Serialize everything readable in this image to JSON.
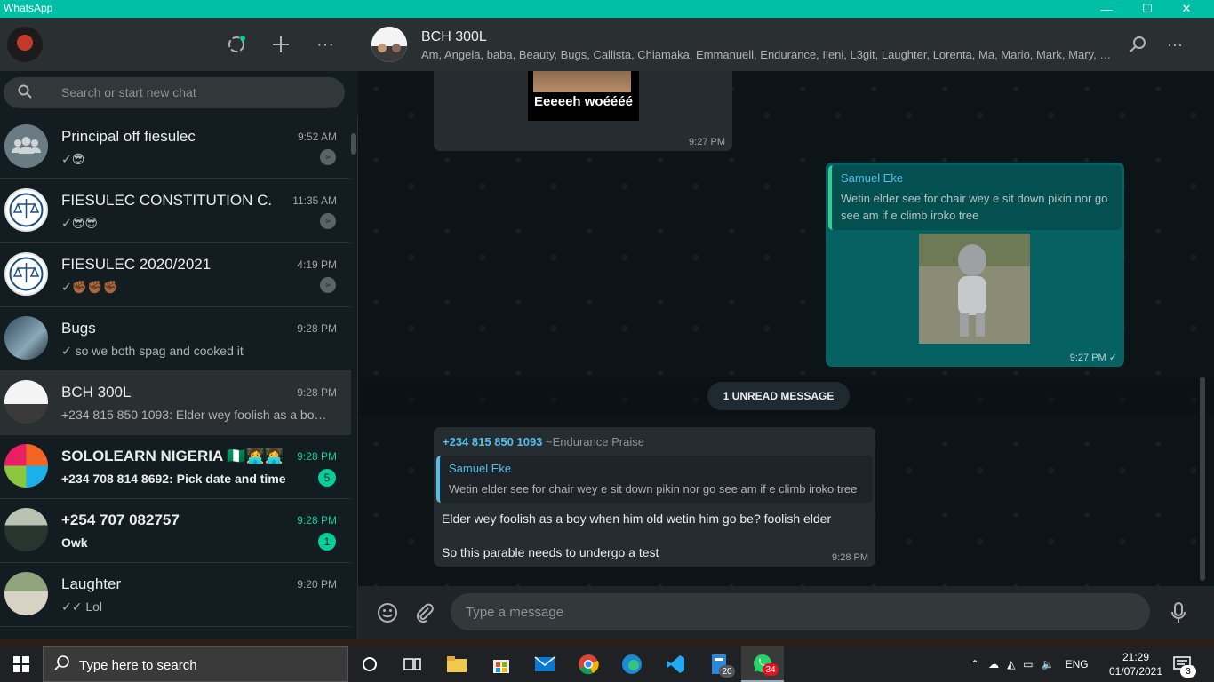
{
  "window": {
    "title": "WhatsApp"
  },
  "left_header": {
    "search_placeholder": "Search or start new chat"
  },
  "chats": [
    {
      "name": "Principal off fiesulec",
      "time": "9:52 AM",
      "preview": "✓😎",
      "pinned": true,
      "unread": "",
      "bold": false
    },
    {
      "name": "FIESULEC CONSTITUTION C.",
      "time": "11:35 AM",
      "preview": "✓😎😎",
      "pinned": true,
      "unread": "",
      "bold": false
    },
    {
      "name": "FIESULEC 2020/2021",
      "time": "4:19 PM",
      "preview": "✓✊🏾✊🏾✊🏾",
      "pinned": true,
      "unread": "",
      "bold": false
    },
    {
      "name": "Bugs",
      "time": "9:28 PM",
      "preview": "✓ so we both spag and cooked it",
      "pinned": false,
      "unread": "",
      "bold": false
    },
    {
      "name": "BCH 300L",
      "time": "9:28 PM",
      "preview": "+234 815 850 1093: Elder wey foolish as a boy ...",
      "pinned": false,
      "unread": "",
      "bold": false
    },
    {
      "name": "SOLOLEARN NIGERIA 🇳🇬👩‍💻👩‍💻",
      "time": "9:28 PM",
      "preview": "+234 708 814 8692: Pick date and time",
      "pinned": false,
      "unread": "5",
      "bold": true
    },
    {
      "name": "+254 707 082757",
      "time": "9:28 PM",
      "preview": "Owk",
      "pinned": false,
      "unread": "1",
      "bold": true
    },
    {
      "name": "Laughter",
      "time": "9:20 PM",
      "preview": "✓✓ Lol",
      "pinned": false,
      "unread": "",
      "bold": false
    }
  ],
  "conversation": {
    "title": "BCH 300L",
    "members": "Am, Angela, baba, Beauty, Bugs, Callista, Chiamaka, Emmanuell, Endurance, Ileni, L3git, Laughter, Lorenta, Ma, Mario, Mark, Mary, My...",
    "messages": {
      "first": {
        "image_caption": "Eeeeeh woéééé",
        "time": "9:27 PM"
      },
      "outgoing": {
        "quote_author": "Samuel Eke",
        "quote_text": "Wetin elder see for chair wey e sit down pikin nor go see am if e climb iroko tree",
        "time": "9:27 PM ✓"
      },
      "unread_label": "1 UNREAD MESSAGE",
      "incoming": {
        "sender": "+234 815 850 1093",
        "sender_name": "~Endurance Praise",
        "quote_author": "Samuel Eke",
        "quote_text": "Wetin elder see for chair wey e sit down pikin nor go see am if e climb iroko tree",
        "line1": "Elder wey foolish as a boy when him old wetin him go be? foolish elder",
        "line2": "So this parable needs to undergo a test",
        "time": "9:28 PM"
      }
    },
    "composer_placeholder": "Type a message"
  },
  "taskbar": {
    "search_placeholder": "Type here to search",
    "files_badge": "20",
    "whatsapp_badge": "34",
    "language": "ENG",
    "time": "21:29",
    "date": "01/07/2021",
    "notifications": "3"
  },
  "icons": {
    "status": "status-icon",
    "new_chat": "plus-icon",
    "menu": "more-vertical-icon",
    "search": "search-icon",
    "emoji": "emoji-icon",
    "attach": "paperclip-icon",
    "mic": "microphone-icon"
  },
  "colors": {
    "accent": "#00bfa5",
    "outgoing_bubble": "#056162",
    "incoming_bubble": "#262d31",
    "unread_badge": "#06cf9c"
  }
}
